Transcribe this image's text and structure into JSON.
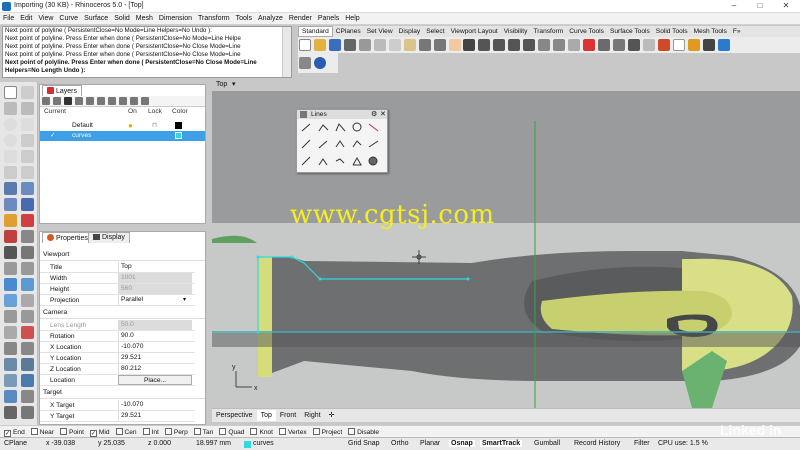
{
  "window": {
    "title": "Importing (30 KB) - Rhinoceros 5.0 - [Top]",
    "controls": [
      "–",
      "□",
      "✕"
    ]
  },
  "menu": [
    "File",
    "Edit",
    "View",
    "Curve",
    "Surface",
    "Solid",
    "Mesh",
    "Dimension",
    "Transform",
    "Tools",
    "Analyze",
    "Render",
    "Panels",
    "Help"
  ],
  "command_history": [
    "Next point of polyline ( PersistentClose=No  Mode=Line  Helpers=No  Undo ):",
    "Next point of polyline. Press Enter when done ( PersistentClose=No  Mode=Line  Helpe",
    "Next point of polyline. Press Enter when done ( PersistentClose=No  Close  Mode=Line",
    "Next point of polyline. Press Enter when done ( PersistentClose=No  Close  Mode=Line",
    "Next point of polyline. Press Enter when done ( PersistentClose=No  Close  Mode=Line",
    "Helpers=No  Length  Undo ):"
  ],
  "toolbar_tabs": [
    "Standard",
    "CPlanes",
    "Set View",
    "Display",
    "Select",
    "Viewport Layout",
    "Visibility",
    "Transform",
    "Curve Tools",
    "Surface Tools",
    "Solid Tools",
    "Mesh Tools",
    "F»"
  ],
  "layers": {
    "tab_label": "Layers",
    "columns": [
      "Current",
      "On",
      "Lock",
      "Color"
    ],
    "rows": [
      {
        "name": "Default",
        "current": "",
        "color": "#000000",
        "selected": false
      },
      {
        "name": "curves",
        "current": "✓",
        "color": "#30d8e0",
        "selected": true
      }
    ]
  },
  "properties": {
    "tabs": [
      "Properties",
      "Display"
    ],
    "sections": [
      {
        "title": "Viewport",
        "rows": [
          {
            "key": "Title",
            "value": "Top",
            "disabled": false
          },
          {
            "key": "Width",
            "value": "1001",
            "disabled": true
          },
          {
            "key": "Height",
            "value": "560",
            "disabled": true
          },
          {
            "key": "Projection",
            "value": "Parallel",
            "disabled": false
          }
        ]
      },
      {
        "title": "Camera",
        "rows": [
          {
            "key": "Lens Length",
            "value": "50.0",
            "disabled": true
          },
          {
            "key": "Rotation",
            "value": "90.0",
            "disabled": false
          },
          {
            "key": "X Location",
            "value": "-10.070",
            "disabled": false
          },
          {
            "key": "Y Location",
            "value": "29.521",
            "disabled": false
          },
          {
            "key": "Z Location",
            "value": "80.212",
            "disabled": false
          },
          {
            "key": "Location",
            "value": "Place...",
            "disabled": false
          }
        ]
      },
      {
        "title": "Target",
        "rows": [
          {
            "key": "X Target",
            "value": "-10.070",
            "disabled": false
          },
          {
            "key": "Y Target",
            "value": "29.521",
            "disabled": false
          }
        ]
      }
    ]
  },
  "viewport": {
    "label": "Top",
    "tabs": [
      "Perspective",
      "Top",
      "Front",
      "Right"
    ],
    "axis_x": "x",
    "axis_y": "y"
  },
  "floating_toolbar": {
    "title": "Lines"
  },
  "osnap": [
    {
      "label": "End",
      "checked": true
    },
    {
      "label": "Near",
      "checked": false
    },
    {
      "label": "Point",
      "checked": false
    },
    {
      "label": "Mid",
      "checked": true
    },
    {
      "label": "Cen",
      "checked": false
    },
    {
      "label": "Int",
      "checked": false
    },
    {
      "label": "Perp",
      "checked": false
    },
    {
      "label": "Tan",
      "checked": false
    },
    {
      "label": "Quad",
      "checked": false
    },
    {
      "label": "Knot",
      "checked": false
    },
    {
      "label": "Vertex",
      "checked": false
    },
    {
      "label": "Project",
      "checked": false
    },
    {
      "label": "Disable",
      "checked": false
    }
  ],
  "status": {
    "cplane": "CPlane",
    "x": "x -39.038",
    "y": "y 25.035",
    "z": "z 0.000",
    "distance": "18.997 mm",
    "layer": "curves",
    "toggles": [
      "Grid Snap",
      "Ortho",
      "Planar",
      "Osnap",
      "SmartTrack",
      "Gumball",
      "Record History",
      "Filter"
    ],
    "cpu": "CPU use: 1.5 %"
  },
  "watermark": "www.cgtsj.com",
  "brand": "Linked in",
  "colors": {
    "accent_cyan": "#30d8e0",
    "handle_yellow": "#d8e07a",
    "viewport_bg": "#a7a8a9"
  }
}
